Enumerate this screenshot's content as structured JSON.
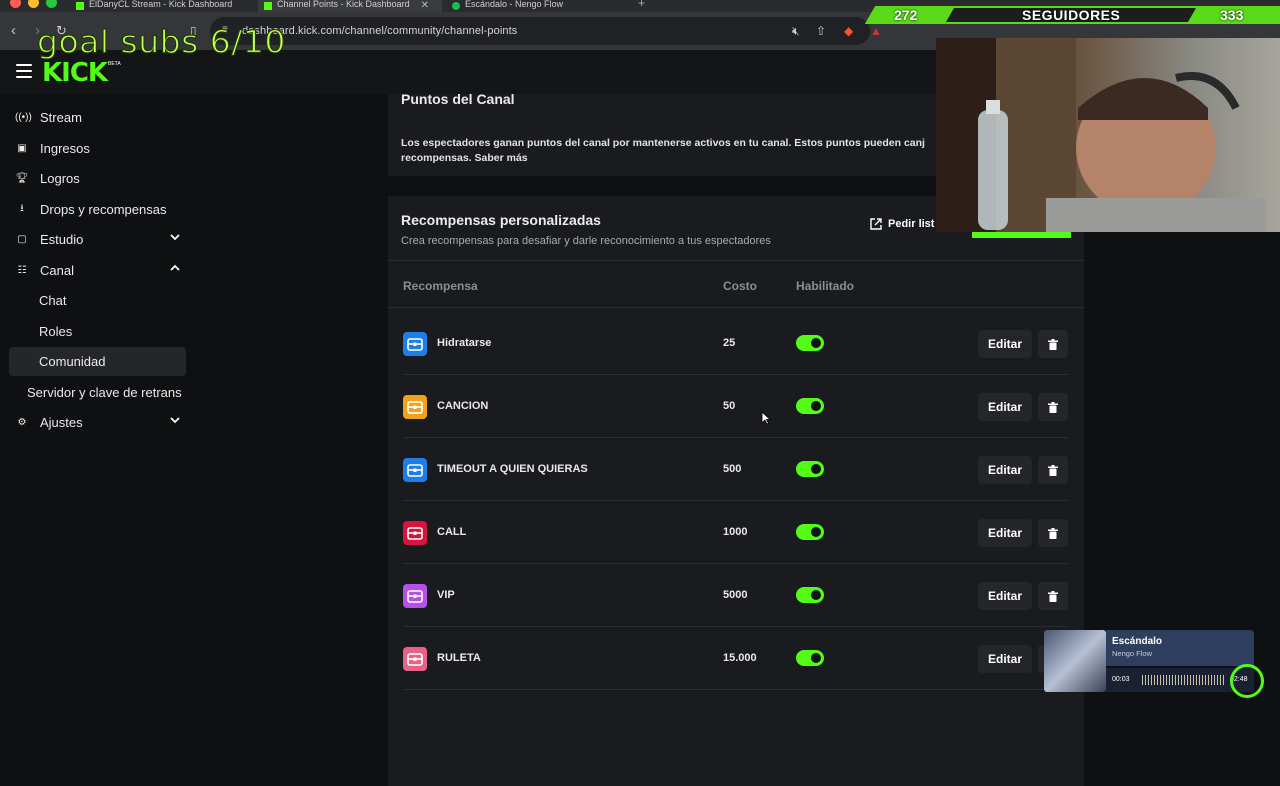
{
  "browser": {
    "tabs": [
      {
        "title": "ElDanyCL Stream - Kick Dashboard"
      },
      {
        "title": "Channel Points - Kick Dashboard"
      },
      {
        "title": "Escándalo - Nengo Flow"
      }
    ],
    "url": "dashboard.kick.com/channel/community/channel-points"
  },
  "overlay": {
    "goal_text": "goal subs 6/10",
    "followers_label": "SEGUIDORES",
    "followers_current": "272",
    "followers_goal": "333"
  },
  "header": {
    "logo": "KICK",
    "beta": "BETA"
  },
  "sidebar": {
    "items": [
      {
        "label": "Stream",
        "icon": "broadcast-icon"
      },
      {
        "label": "Ingresos",
        "icon": "chart-icon"
      },
      {
        "label": "Logros",
        "icon": "trophy-icon"
      },
      {
        "label": "Drops y recompensas",
        "icon": "drops-icon"
      },
      {
        "label": "Estudio",
        "icon": "studio-icon"
      },
      {
        "label": "Canal",
        "icon": "channel-icon"
      },
      {
        "label": "Chat"
      },
      {
        "label": "Roles"
      },
      {
        "label": "Comunidad"
      },
      {
        "label": "Servidor y clave de retrans"
      },
      {
        "label": "Ajustes",
        "icon": "gear-icon"
      }
    ]
  },
  "channel_points": {
    "title": "Puntos del Canal",
    "description": "Los espectadores ganan puntos del canal por mantenerse activos en tu canal. Estos puntos pueden canj recompensas. Saber más"
  },
  "custom_rewards": {
    "title": "Recompensas personalizadas",
    "subtitle": "Crea recompensas para desafiar y darle reconocimiento a tus espectadores",
    "request_button": "Pedir list",
    "columns": {
      "reward": "Recompensa",
      "cost": "Costo",
      "enabled": "Habilitado"
    },
    "edit_label": "Editar",
    "rows": [
      {
        "name": "Hidratarse",
        "cost": "25",
        "color": "#1e7ee8",
        "enabled": true
      },
      {
        "name": "CANCION",
        "cost": "50",
        "color": "#f0a21b",
        "enabled": true
      },
      {
        "name": "TIMEOUT A QUIEN QUIERAS",
        "cost": "500",
        "color": "#1e7ee8",
        "enabled": true
      },
      {
        "name": "CALL",
        "cost": "1000",
        "color": "#d8143c",
        "enabled": true
      },
      {
        "name": "VIP",
        "cost": "5000",
        "color": "#b451e8",
        "enabled": true
      },
      {
        "name": "RULETA",
        "cost": "15.000",
        "color": "#e8628a",
        "enabled": true
      }
    ]
  },
  "player": {
    "title": "Escándalo",
    "artist": "Nengo Flow",
    "elapsed": "00:03",
    "total": "02:48"
  },
  "colors": {
    "accent": "#53fc18",
    "background": "#0f1011",
    "card": "#191b1e"
  }
}
